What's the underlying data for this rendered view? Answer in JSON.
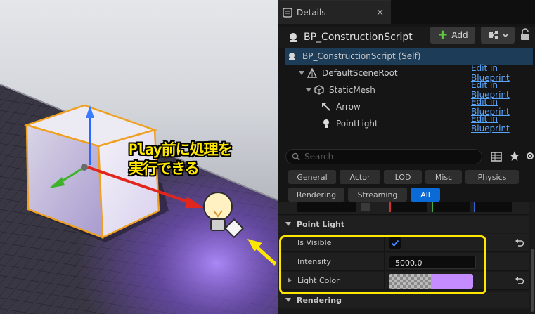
{
  "viewport": {
    "annotation_line1": "Play前に処理を",
    "annotation_line2": "実行できる"
  },
  "details": {
    "tab_label": "Details",
    "tab_close": "✕",
    "actor_title": "BP_ConstructionScript",
    "add_label": "Add",
    "tree": [
      {
        "label": "BP_ConstructionScript (Self)",
        "link": ""
      },
      {
        "label": "DefaultSceneRoot",
        "link": "Edit in Blueprint"
      },
      {
        "label": "StaticMesh",
        "link": "Edit in Blueprint"
      },
      {
        "label": "Arrow",
        "link": "Edit in Blueprint"
      },
      {
        "label": "PointLight",
        "link": "Edit in Blueprint"
      }
    ],
    "search_placeholder": "Search",
    "categories": [
      "General",
      "Actor",
      "LOD",
      "Misc",
      "Physics",
      "Rendering",
      "Streaming",
      "All"
    ],
    "active_category": "All",
    "section_point_light": "Point Light",
    "section_rendering": "Rendering",
    "props": {
      "is_visible_label": "Is Visible",
      "is_visible_value": true,
      "intensity_label": "Intensity",
      "intensity_value": "5000.0",
      "light_color_label": "Light Color",
      "light_color_value": "#c58cff"
    }
  },
  "colors": {
    "accent_blue": "#0a6ad6",
    "link_blue": "#5aa6ff",
    "highlight_yellow": "#ffe600",
    "selection": "#1d3c57"
  }
}
